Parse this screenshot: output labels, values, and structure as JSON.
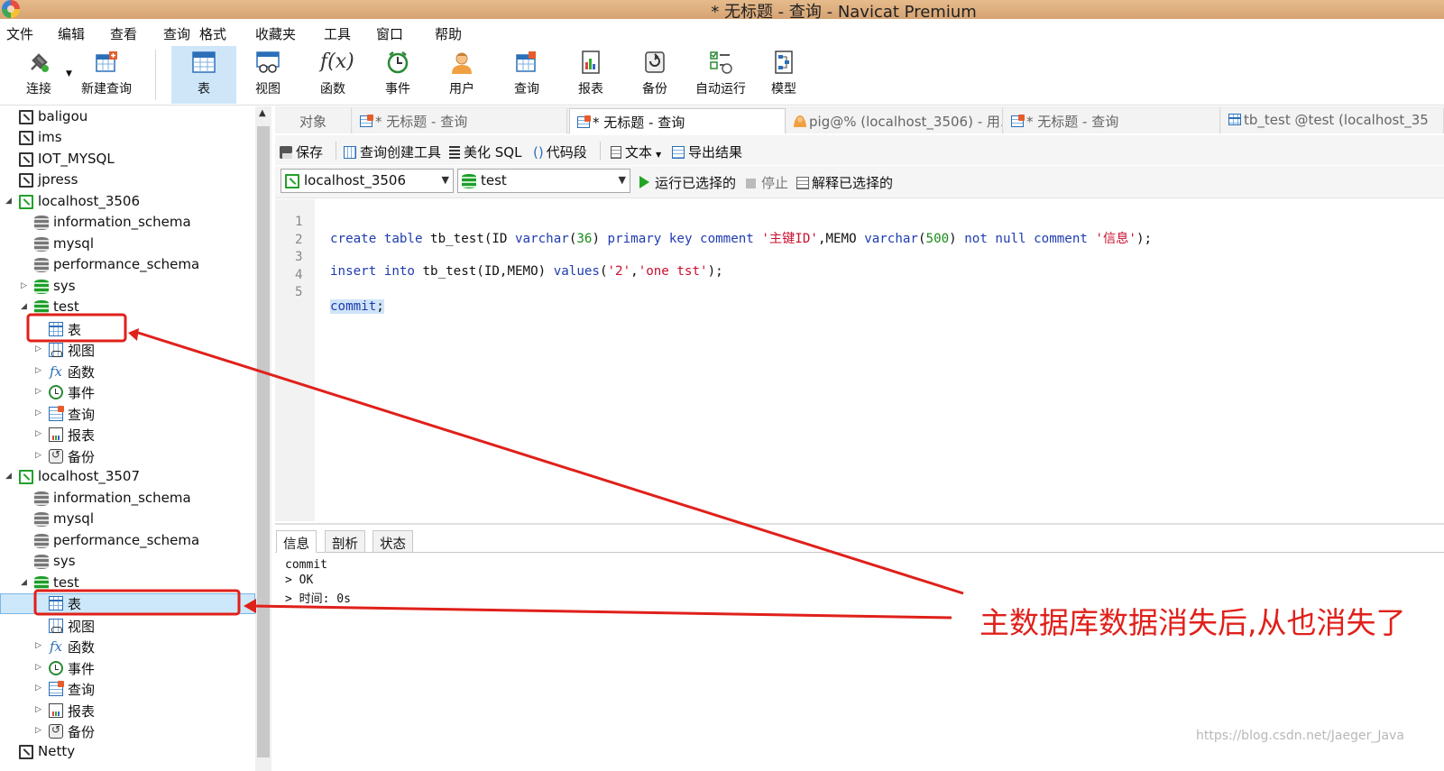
{
  "window": {
    "title": "* 无标题 - 查询 - Navicat Premium"
  },
  "menu": [
    "文件",
    "编辑",
    "查看",
    "查询",
    "格式",
    "收藏夹",
    "工具",
    "窗口",
    "帮助"
  ],
  "toolbar": {
    "connect": "连接",
    "new_query": "新建查询",
    "table": "表",
    "view": "视图",
    "function": "函数",
    "event": "事件",
    "user": "用户",
    "query": "查询",
    "report": "报表",
    "backup": "备份",
    "automation": "自动运行",
    "model": "模型"
  },
  "tree": [
    {
      "label": "baligou"
    },
    {
      "label": "ims"
    },
    {
      "label": "IOT_MYSQL"
    },
    {
      "label": "jpress"
    },
    {
      "label": "localhost_3506"
    },
    {
      "label": "information_schema"
    },
    {
      "label": "mysql"
    },
    {
      "label": "performance_schema"
    },
    {
      "label": "sys"
    },
    {
      "label": "test"
    },
    {
      "label": "表"
    },
    {
      "label": "视图"
    },
    {
      "label": "函数"
    },
    {
      "label": "事件"
    },
    {
      "label": "查询"
    },
    {
      "label": "报表"
    },
    {
      "label": "备份"
    },
    {
      "label": "localhost_3507"
    },
    {
      "label": "information_schema"
    },
    {
      "label": "mysql"
    },
    {
      "label": "performance_schema"
    },
    {
      "label": "sys"
    },
    {
      "label": "test"
    },
    {
      "label": "表"
    },
    {
      "label": "视图"
    },
    {
      "label": "函数"
    },
    {
      "label": "事件"
    },
    {
      "label": "查询"
    },
    {
      "label": "报表"
    },
    {
      "label": "备份"
    },
    {
      "label": "Netty"
    }
  ],
  "tabs": [
    "对象",
    "* 无标题 - 查询",
    "* 无标题 - 查询",
    "pig@% (localhost_3506) - 用...",
    "* 无标题 - 查询",
    "tb_test @test (localhost_35"
  ],
  "editor_toolbar": {
    "save": "保存",
    "query_builder": "查询创建工具",
    "beautify": "美化 SQL",
    "snippet": "代码段",
    "text": "文本",
    "export": "导出结果"
  },
  "run_bar": {
    "connection": "localhost_3506",
    "database": "test",
    "run_selected": "运行已选择的",
    "stop": "停止",
    "explain": "解释已选择的"
  },
  "code": {
    "line_numbers": [
      "1",
      "2",
      "3",
      "4",
      "5"
    ],
    "line1": {
      "a": "create table ",
      "b": "tb_test(ID ",
      "c": "varchar",
      "d": "(",
      "e": "36",
      "f": ") ",
      "g": "primary key comment ",
      "h": "'主键ID'",
      "i": ",MEMO ",
      "j": "varchar",
      "k": "(",
      "l": "500",
      "m": ") ",
      "n": "not null comment ",
      "o": "'信息'",
      "p": ");"
    },
    "line3": {
      "a": "insert into ",
      "b": "tb_test(ID,MEMO) ",
      "c": "values",
      "d": "(",
      "e": "'2'",
      "f": ",",
      "g": "'one tst'",
      "h": ");"
    },
    "line5": {
      "a": "commit",
      "b": ";"
    }
  },
  "output": {
    "tabs": [
      "信息",
      "剖析",
      "状态"
    ],
    "lines": [
      "commit",
      "> OK",
      "> 时间: 0s"
    ]
  },
  "annotation": {
    "text": "主数据库数据消失后,从也消失了",
    "color": "#e0201a"
  },
  "watermark": "https://blog.csdn.net/Jaeger_Java"
}
